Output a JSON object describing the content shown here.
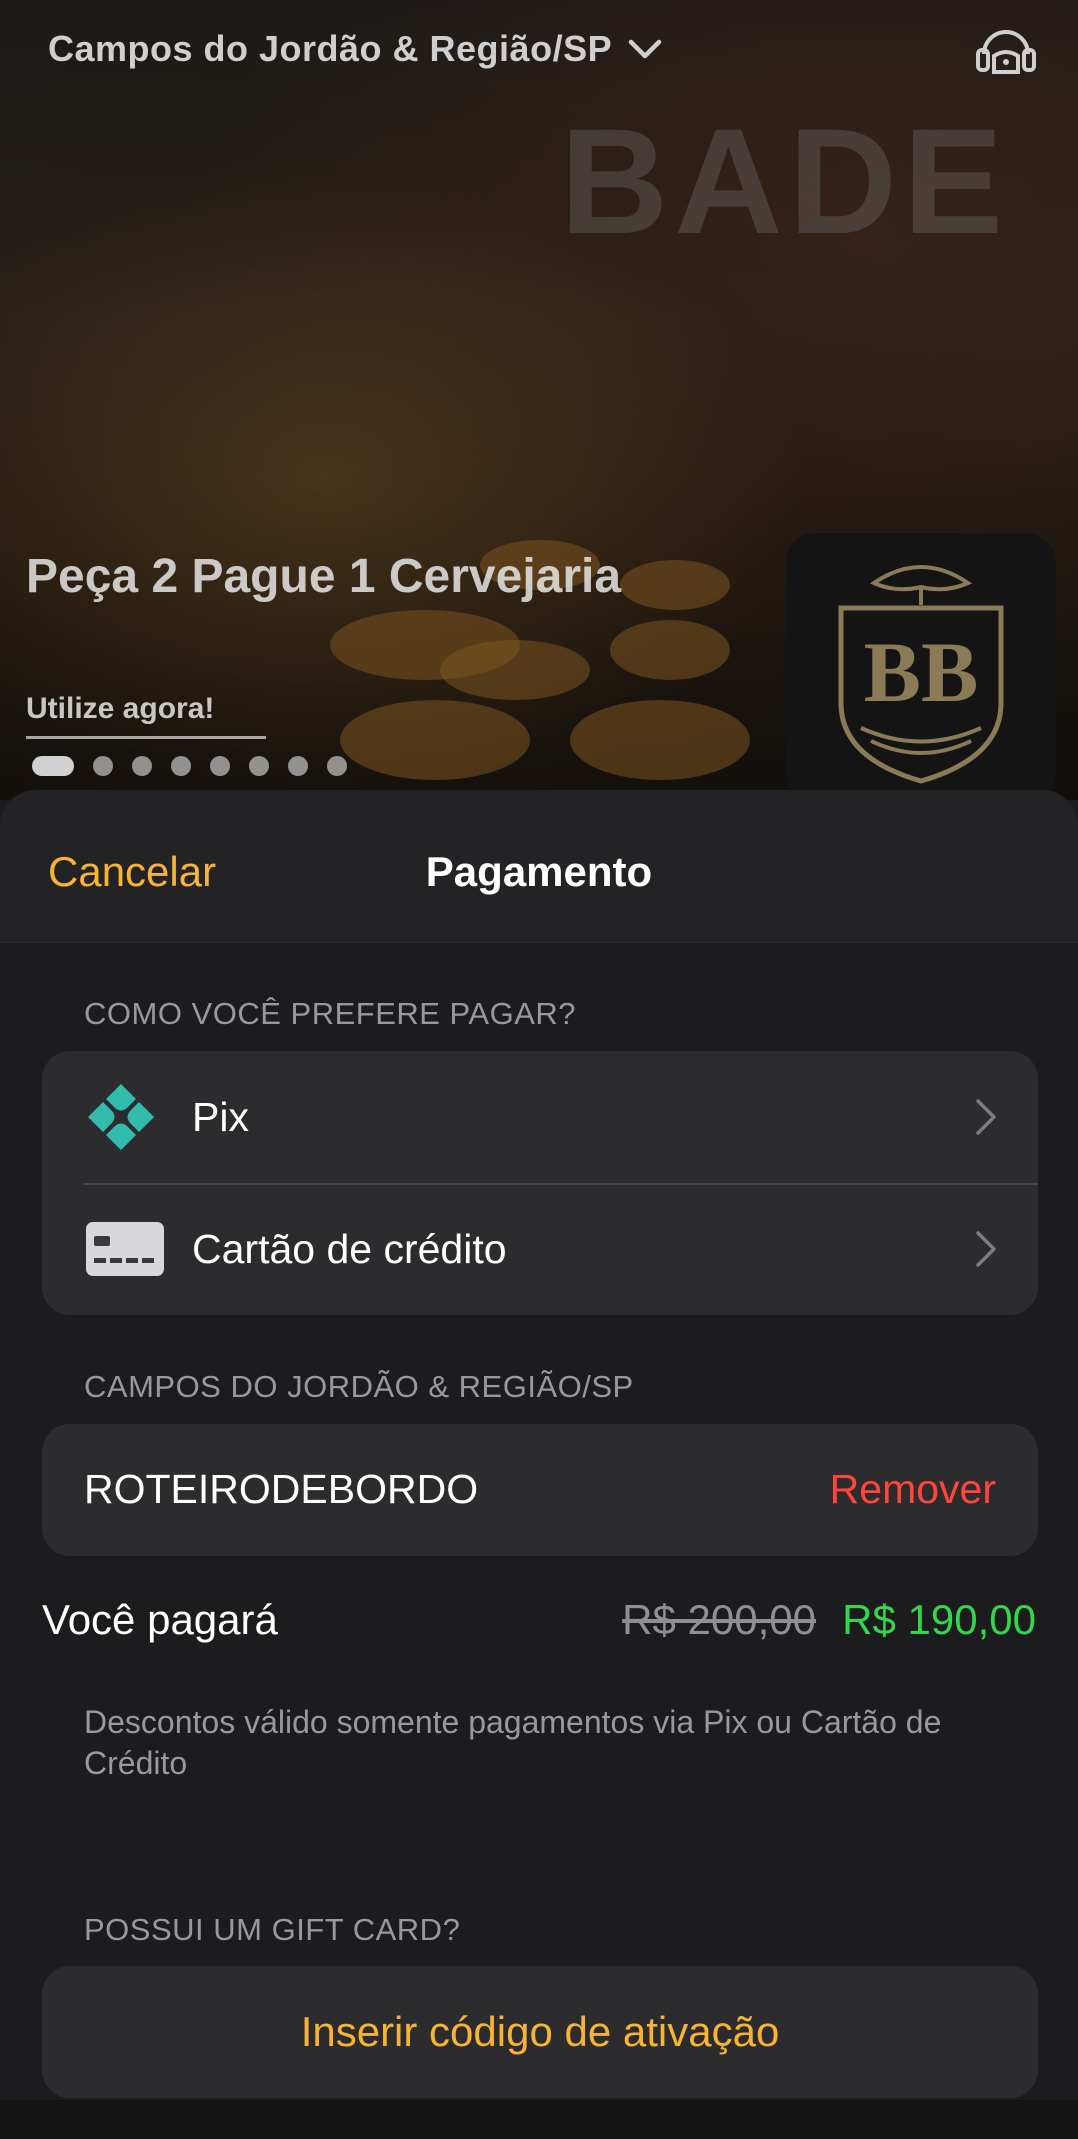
{
  "header": {
    "location": "Campos do Jordão & Região/SP",
    "location_icon": "chevron-down-icon",
    "support_icon": "headset-icon"
  },
  "banner": {
    "background_text": "BADE",
    "promo_title": "Peça 2 Pague 1 Cervejaria",
    "promo_cta": "Utilize agora!",
    "slide_count": 8,
    "active_slide": 1,
    "logo_text": "BB"
  },
  "sheet": {
    "cancel_label": "Cancelar",
    "title": "Pagamento"
  },
  "payment": {
    "section_label": "COMO VOCÊ PREFERE PAGAR?",
    "methods": [
      {
        "label": "Pix",
        "icon": "pix-icon"
      },
      {
        "label": "Cartão de crédito",
        "icon": "credit-card-icon"
      }
    ]
  },
  "coupon": {
    "section_label": "CAMPOS DO JORDÃO & REGIÃO/SP",
    "code": "ROTEIRODEBORDO",
    "remove_label": "Remover"
  },
  "summary": {
    "label": "Você pagará",
    "old_price": "R$ 200,00",
    "new_price": "R$ 190,00",
    "disclaimer": "Descontos válido somente pagamentos via Pix ou Cartão de Crédito"
  },
  "gift_card": {
    "section_label": "POSSUI UM GIFT CARD?",
    "button_label": "Inserir código de ativação"
  },
  "colors": {
    "accent": "#f7b334",
    "danger": "#ff453a",
    "success": "#32d74b",
    "pix": "#32bcad",
    "card_bg": "#2c2c2e",
    "sheet_bg": "#1c1c1e"
  }
}
